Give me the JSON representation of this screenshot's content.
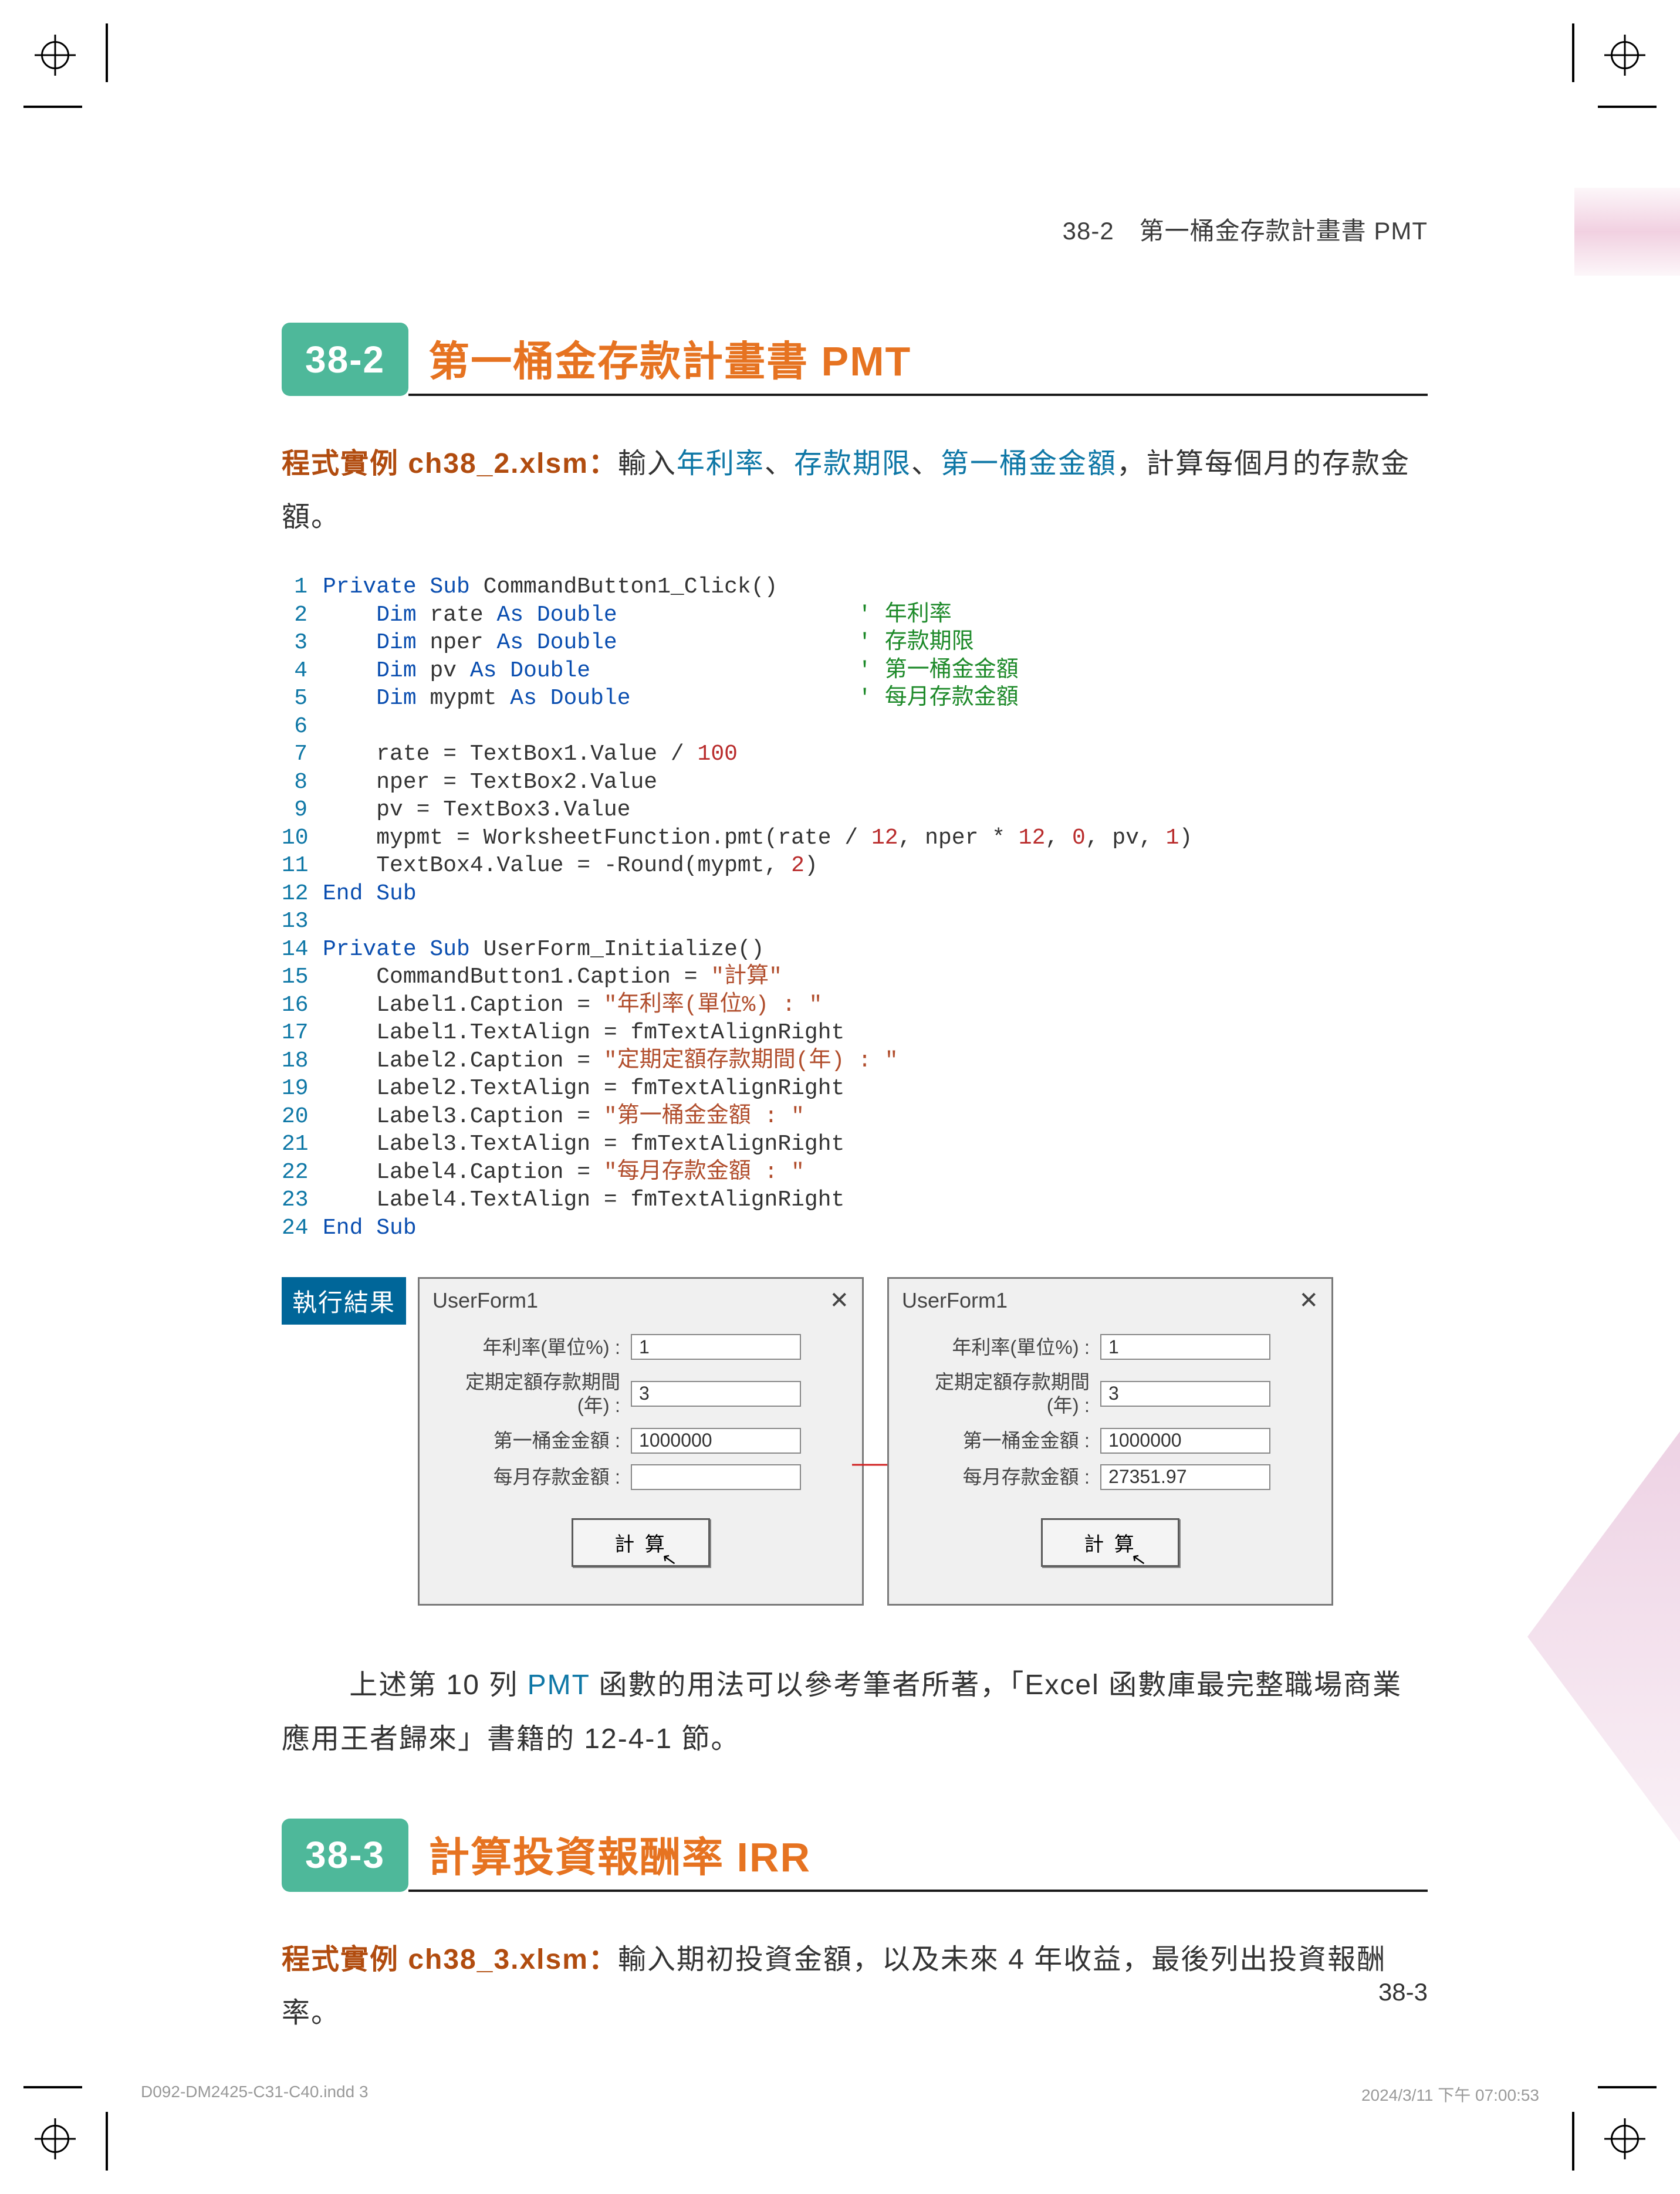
{
  "header": {
    "runningHead": "38-2　第一桶金存款計畫書 PMT"
  },
  "section1": {
    "badge": "38-2",
    "title": "第一桶金存款計畫書 PMT",
    "intro": {
      "prefix": "程式實例 ch38_2.xlsm：",
      "t1": "輸入",
      "kw1": "年利率",
      "sep": "、",
      "kw2": "存款期限",
      "kw3": "第一桶金金額",
      "tail": "，計算每個月的存款金額。"
    }
  },
  "code1": [
    {
      "n": "1",
      "parts": [
        {
          "c": "kw",
          "t": "Private Sub"
        },
        {
          "c": "",
          "t": " CommandButton1_Click()"
        }
      ]
    },
    {
      "n": "2",
      "parts": [
        {
          "c": "",
          "t": "    "
        },
        {
          "c": "kw",
          "t": "Dim"
        },
        {
          "c": "",
          "t": " rate "
        },
        {
          "c": "kw",
          "t": "As Double"
        },
        {
          "c": "",
          "t": "                  "
        },
        {
          "c": "cmt",
          "t": "' 年利率"
        }
      ]
    },
    {
      "n": "3",
      "parts": [
        {
          "c": "",
          "t": "    "
        },
        {
          "c": "kw",
          "t": "Dim"
        },
        {
          "c": "",
          "t": " nper "
        },
        {
          "c": "kw",
          "t": "As Double"
        },
        {
          "c": "",
          "t": "                  "
        },
        {
          "c": "cmt",
          "t": "' 存款期限"
        }
      ]
    },
    {
      "n": "4",
      "parts": [
        {
          "c": "",
          "t": "    "
        },
        {
          "c": "kw",
          "t": "Dim"
        },
        {
          "c": "",
          "t": " pv "
        },
        {
          "c": "kw",
          "t": "As Double"
        },
        {
          "c": "",
          "t": "                    "
        },
        {
          "c": "cmt",
          "t": "' 第一桶金金額"
        }
      ]
    },
    {
      "n": "5",
      "parts": [
        {
          "c": "",
          "t": "    "
        },
        {
          "c": "kw",
          "t": "Dim"
        },
        {
          "c": "",
          "t": " mypmt "
        },
        {
          "c": "kw",
          "t": "As Double"
        },
        {
          "c": "",
          "t": "                 "
        },
        {
          "c": "cmt",
          "t": "' 每月存款金額"
        }
      ]
    },
    {
      "n": "6",
      "parts": [
        {
          "c": "",
          "t": "    "
        }
      ]
    },
    {
      "n": "7",
      "parts": [
        {
          "c": "",
          "t": "    rate = TextBox1.Value / "
        },
        {
          "c": "num",
          "t": "100"
        }
      ]
    },
    {
      "n": "8",
      "parts": [
        {
          "c": "",
          "t": "    nper = TextBox2.Value"
        }
      ]
    },
    {
      "n": "9",
      "parts": [
        {
          "c": "",
          "t": "    pv = TextBox3.Value"
        }
      ]
    },
    {
      "n": "10",
      "parts": [
        {
          "c": "",
          "t": "    mypmt = WorksheetFunction.pmt(rate / "
        },
        {
          "c": "num",
          "t": "12"
        },
        {
          "c": "",
          "t": ", nper * "
        },
        {
          "c": "num",
          "t": "12"
        },
        {
          "c": "",
          "t": ", "
        },
        {
          "c": "num",
          "t": "0"
        },
        {
          "c": "",
          "t": ", pv, "
        },
        {
          "c": "num",
          "t": "1"
        },
        {
          "c": "",
          "t": ")"
        }
      ]
    },
    {
      "n": "11",
      "parts": [
        {
          "c": "",
          "t": "    TextBox4.Value = -Round(mypmt, "
        },
        {
          "c": "num",
          "t": "2"
        },
        {
          "c": "",
          "t": ")"
        }
      ]
    },
    {
      "n": "12",
      "parts": [
        {
          "c": "kw",
          "t": "End Sub"
        }
      ]
    },
    {
      "n": "13",
      "parts": [
        {
          "c": "",
          "t": ""
        }
      ]
    },
    {
      "n": "14",
      "parts": [
        {
          "c": "kw",
          "t": "Private Sub"
        },
        {
          "c": "",
          "t": " UserForm_Initialize()"
        }
      ]
    },
    {
      "n": "15",
      "parts": [
        {
          "c": "",
          "t": "    CommandButton1.Caption = "
        },
        {
          "c": "str",
          "t": "\"計算\""
        }
      ]
    },
    {
      "n": "16",
      "parts": [
        {
          "c": "",
          "t": "    Label1.Caption = "
        },
        {
          "c": "str",
          "t": "\"年利率(單位%) : \""
        }
      ]
    },
    {
      "n": "17",
      "parts": [
        {
          "c": "",
          "t": "    Label1.TextAlign = fmTextAlignRight"
        }
      ]
    },
    {
      "n": "18",
      "parts": [
        {
          "c": "",
          "t": "    Label2.Caption = "
        },
        {
          "c": "str",
          "t": "\"定期定額存款期間(年) : \""
        }
      ]
    },
    {
      "n": "19",
      "parts": [
        {
          "c": "",
          "t": "    Label2.TextAlign = fmTextAlignRight"
        }
      ]
    },
    {
      "n": "20",
      "parts": [
        {
          "c": "",
          "t": "    Label3.Caption = "
        },
        {
          "c": "str",
          "t": "\"第一桶金金額 : \""
        }
      ]
    },
    {
      "n": "21",
      "parts": [
        {
          "c": "",
          "t": "    Label3.TextAlign = fmTextAlignRight"
        }
      ]
    },
    {
      "n": "22",
      "parts": [
        {
          "c": "",
          "t": "    Label4.Caption = "
        },
        {
          "c": "str",
          "t": "\"每月存款金額 : \""
        }
      ]
    },
    {
      "n": "23",
      "parts": [
        {
          "c": "",
          "t": "    Label4.TextAlign = fmTextAlignRight"
        }
      ]
    },
    {
      "n": "24",
      "parts": [
        {
          "c": "kw",
          "t": "End Sub"
        }
      ]
    }
  ],
  "resultLabel": "執行結果",
  "userformTitle": "UserForm1",
  "closeGlyph": "✕",
  "formLabels": {
    "rate": "年利率(單位%) :",
    "period": "定期定額存款期間(年) :",
    "target": "第一桶金金額 :",
    "monthly": "每月存款金額 :",
    "button": "計 算"
  },
  "formA": {
    "rate": "1",
    "period": "3",
    "target": "1000000",
    "monthly": ""
  },
  "formB": {
    "rate": "1",
    "period": "3",
    "target": "1000000",
    "monthly": "27351.97"
  },
  "para1": {
    "t1": "上述第 10 列 ",
    "kw": "PMT",
    "t2": " 函數的用法可以參考筆者所著，「Excel 函數庫最完整職場商業應用王者歸來」書籍的 12-4-1 節。"
  },
  "section2": {
    "badge": "38-3",
    "title": "計算投資報酬率 IRR",
    "intro": {
      "prefix": "程式實例 ch38_3.xlsm：",
      "tail": "輸入期初投資金額，以及未來 4 年收益，最後列出投資報酬率。"
    }
  },
  "pageNum": "38-3",
  "footer": {
    "file": "D092-DM2425-C31-C40.indd   3",
    "stamp": "2024/3/11   下午 07:00:53"
  }
}
